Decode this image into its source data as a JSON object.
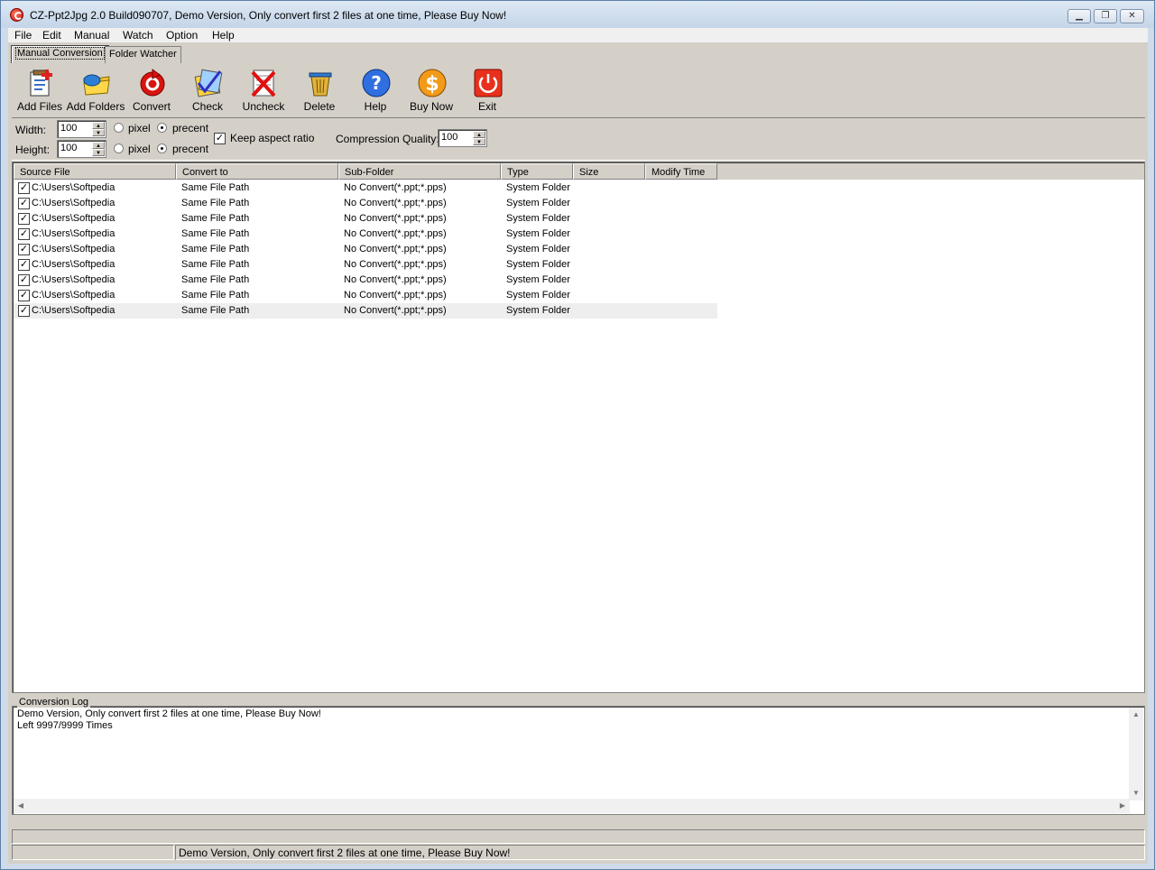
{
  "window": {
    "title": "CZ-Ppt2Jpg 2.0 Build090707, Demo Version, Only convert first 2 files at one time, Please Buy Now!",
    "controls": {
      "minimize": "▁",
      "maximize": "❐",
      "close": "✕"
    }
  },
  "menu": [
    "File",
    "Edit",
    "Manual",
    "Watch",
    "Option",
    "Help"
  ],
  "tabs": [
    {
      "label": "Manual Conversion",
      "active": true
    },
    {
      "label": "Folder Watcher",
      "active": false
    }
  ],
  "toolbar": [
    {
      "label": "Add Files",
      "icon": "add-files-icon"
    },
    {
      "label": "Add Folders",
      "icon": "add-folders-icon"
    },
    {
      "label": "Convert",
      "icon": "convert-icon"
    },
    {
      "label": "Check",
      "icon": "check-icon"
    },
    {
      "label": "Uncheck",
      "icon": "uncheck-icon"
    },
    {
      "label": "Delete",
      "icon": "delete-icon"
    },
    {
      "label": "Help",
      "icon": "help-icon"
    },
    {
      "label": "Buy Now",
      "icon": "buy-now-icon"
    },
    {
      "label": "Exit",
      "icon": "exit-icon"
    }
  ],
  "options": {
    "width_label": "Width:",
    "width_value": "100",
    "height_label": "Height:",
    "height_value": "100",
    "pixel_label": "pixel",
    "percent_label": "precent",
    "keep_aspect_label": "Keep aspect ratio",
    "keep_aspect_checked": true,
    "compression_label": "Compression Quality:",
    "compression_value": "100"
  },
  "list": {
    "columns": [
      "Source File",
      "Convert to",
      "Sub-Folder",
      "Type",
      "Size",
      "Modify Time"
    ],
    "rows": [
      {
        "source": "C:\\Users\\Softpedia",
        "convert_to": "Same File Path",
        "sub_folder": "No Convert(*.ppt;*.pps)",
        "type": "System Folder",
        "size": "",
        "modify_time": "",
        "checked": true
      },
      {
        "source": "C:\\Users\\Softpedia",
        "convert_to": "Same File Path",
        "sub_folder": "No Convert(*.ppt;*.pps)",
        "type": "System Folder",
        "size": "",
        "modify_time": "",
        "checked": true
      },
      {
        "source": "C:\\Users\\Softpedia",
        "convert_to": "Same File Path",
        "sub_folder": "No Convert(*.ppt;*.pps)",
        "type": "System Folder",
        "size": "",
        "modify_time": "",
        "checked": true
      },
      {
        "source": "C:\\Users\\Softpedia",
        "convert_to": "Same File Path",
        "sub_folder": "No Convert(*.ppt;*.pps)",
        "type": "System Folder",
        "size": "",
        "modify_time": "",
        "checked": true
      },
      {
        "source": "C:\\Users\\Softpedia",
        "convert_to": "Same File Path",
        "sub_folder": "No Convert(*.ppt;*.pps)",
        "type": "System Folder",
        "size": "",
        "modify_time": "",
        "checked": true
      },
      {
        "source": "C:\\Users\\Softpedia",
        "convert_to": "Same File Path",
        "sub_folder": "No Convert(*.ppt;*.pps)",
        "type": "System Folder",
        "size": "",
        "modify_time": "",
        "checked": true
      },
      {
        "source": "C:\\Users\\Softpedia",
        "convert_to": "Same File Path",
        "sub_folder": "No Convert(*.ppt;*.pps)",
        "type": "System Folder",
        "size": "",
        "modify_time": "",
        "checked": true
      },
      {
        "source": "C:\\Users\\Softpedia",
        "convert_to": "Same File Path",
        "sub_folder": "No Convert(*.ppt;*.pps)",
        "type": "System Folder",
        "size": "",
        "modify_time": "",
        "checked": true
      },
      {
        "source": "C:\\Users\\Softpedia",
        "convert_to": "Same File Path",
        "sub_folder": "No Convert(*.ppt;*.pps)",
        "type": "System Folder",
        "size": "",
        "modify_time": "",
        "checked": true
      }
    ]
  },
  "log": {
    "caption": "Conversion Log",
    "lines": [
      "Demo Version, Only convert first 2 files at one time, Please Buy Now!",
      "Left 9997/9999 Times"
    ]
  },
  "status": {
    "panel1": "",
    "panel2": "Demo Version, Only convert first 2 files at one time, Please Buy Now!"
  }
}
